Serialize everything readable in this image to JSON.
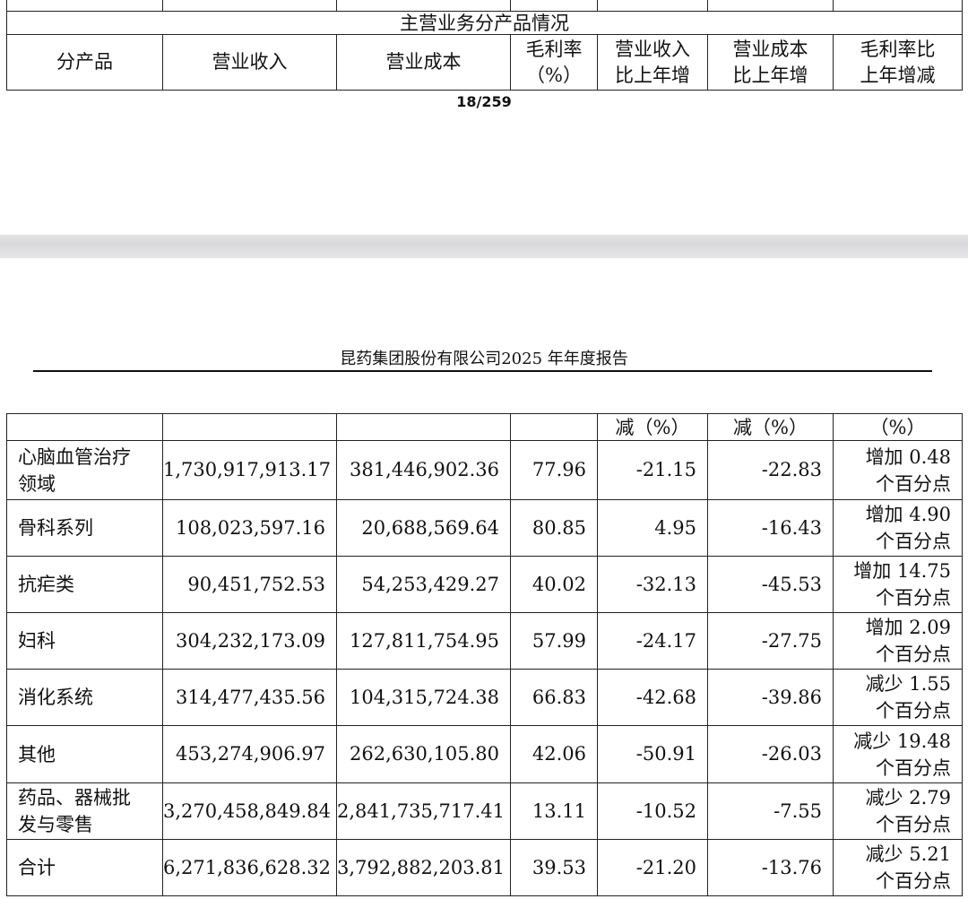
{
  "top_table": {
    "section_title": "主营业务分产品情况",
    "headers": [
      "分产品",
      "营业收入",
      "营业成本",
      "毛利率（%）",
      "营业收入比上年增",
      "营业成本比上年增",
      "毛利率比上年增减"
    ],
    "headers_lines": [
      [
        "分产品"
      ],
      [
        "营业收入"
      ],
      [
        "营业成本"
      ],
      [
        "毛利率",
        "（%）"
      ],
      [
        "营业收入",
        "比上年增"
      ],
      [
        "营业成本",
        "比上年增"
      ],
      [
        "毛利率比",
        "上年增减"
      ]
    ]
  },
  "page_number": "18/259",
  "report_header": "昆药集团股份有限公司2025 年年度报告",
  "continued_header": [
    "",
    "",
    "",
    "",
    "减（%）",
    "减（%）",
    "（%）"
  ],
  "rows": [
    {
      "product": "心脑血管治疗领域",
      "product_lines": [
        "心脑血管治疗",
        "领域"
      ],
      "revenue": "1,730,917,913.17",
      "cost": "381,446,902.36",
      "margin": "77.96",
      "rev_change": "-21.15",
      "cost_change": "-22.83",
      "margin_change_lines": [
        "增加 0.48",
        "个百分点"
      ]
    },
    {
      "product": "骨科系列",
      "product_lines": [
        "骨科系列"
      ],
      "revenue": "108,023,597.16",
      "cost": "20,688,569.64",
      "margin": "80.85",
      "rev_change": "4.95",
      "cost_change": "-16.43",
      "margin_change_lines": [
        "增加 4.90",
        "个百分点"
      ]
    },
    {
      "product": "抗疟类",
      "product_lines": [
        "抗疟类"
      ],
      "revenue": "90,451,752.53",
      "cost": "54,253,429.27",
      "margin": "40.02",
      "rev_change": "-32.13",
      "cost_change": "-45.53",
      "margin_change_lines": [
        "增加 14.75",
        "个百分点"
      ]
    },
    {
      "product": "妇科",
      "product_lines": [
        "妇科"
      ],
      "revenue": "304,232,173.09",
      "cost": "127,811,754.95",
      "margin": "57.99",
      "rev_change": "-24.17",
      "cost_change": "-27.75",
      "margin_change_lines": [
        "增加 2.09",
        "个百分点"
      ]
    },
    {
      "product": "消化系统",
      "product_lines": [
        "消化系统"
      ],
      "revenue": "314,477,435.56",
      "cost": "104,315,724.38",
      "margin": "66.83",
      "rev_change": "-42.68",
      "cost_change": "-39.86",
      "margin_change_lines": [
        "减少 1.55",
        "个百分点"
      ]
    },
    {
      "product": "其他",
      "product_lines": [
        "其他"
      ],
      "revenue": "453,274,906.97",
      "cost": "262,630,105.80",
      "margin": "42.06",
      "rev_change": "-50.91",
      "cost_change": "-26.03",
      "margin_change_lines": [
        "减少 19.48",
        "个百分点"
      ]
    },
    {
      "product": "药品、器械批发与零售",
      "product_lines": [
        "药品、器械批",
        "发与零售"
      ],
      "revenue": "3,270,458,849.84",
      "cost": "2,841,735,717.41",
      "margin": "13.11",
      "rev_change": "-10.52",
      "cost_change": "-7.55",
      "margin_change_lines": [
        "减少 2.79",
        "个百分点"
      ]
    },
    {
      "product": "合计",
      "product_lines": [
        "合计"
      ],
      "revenue": "6,271,836,628.32",
      "cost": "3,792,882,203.81",
      "margin": "39.53",
      "rev_change": "-21.20",
      "cost_change": "-13.76",
      "margin_change_lines": [
        "减少 5.21",
        "个百分点"
      ]
    }
  ]
}
